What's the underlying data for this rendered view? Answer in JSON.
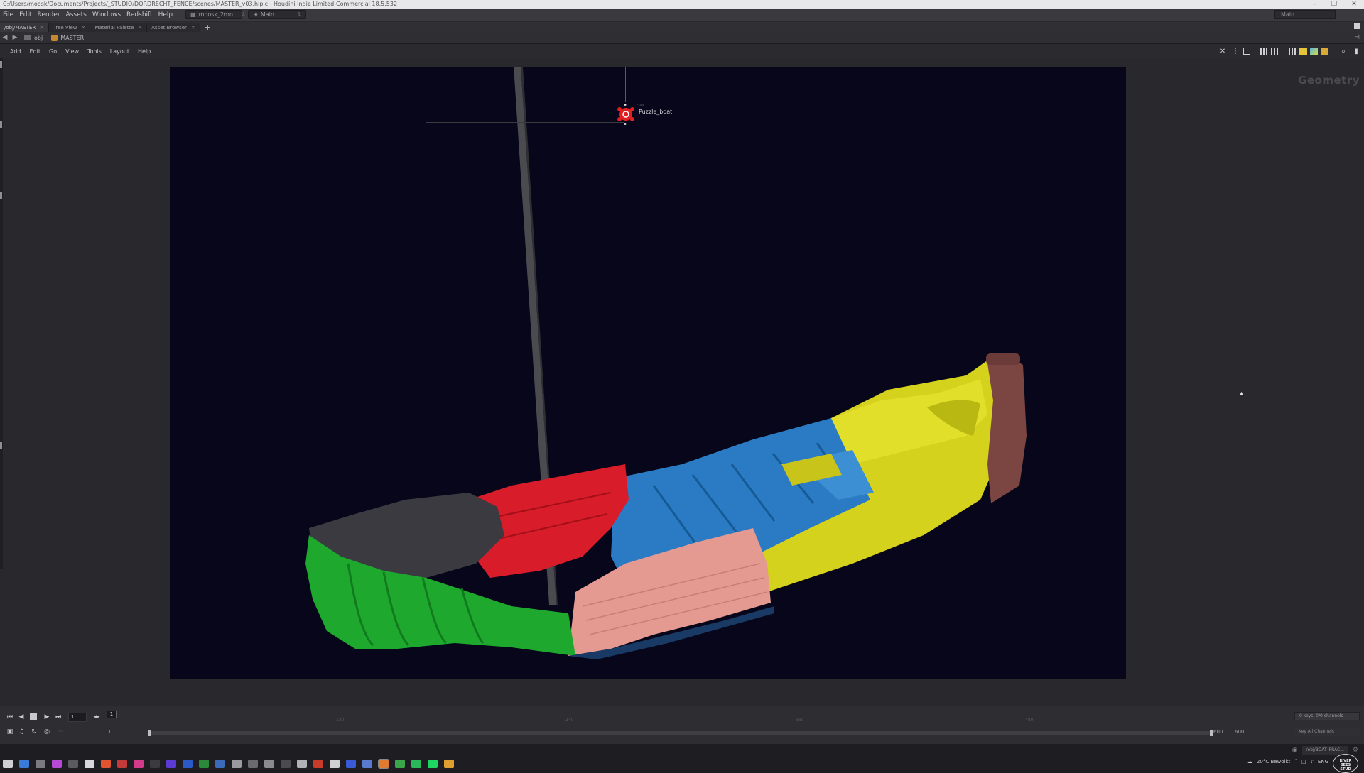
{
  "window": {
    "title": "C:/Users/moosk/Documents/Projects/_STUDIO/DORDRECHT_FENCE/scenes/MASTER_v03.hiplc - Houdini Indie Limited-Commercial 18.5.532",
    "controls": [
      "–",
      "❐",
      "✕"
    ]
  },
  "menubar": {
    "items": [
      "File",
      "Edit",
      "Render",
      "Assets",
      "Windows",
      "Redshift",
      "Help"
    ],
    "desktop_value": "moosk_2mo...",
    "main_value": "Main",
    "right_value": "Main"
  },
  "tabs": [
    {
      "label": "/obj/MASTER",
      "active": true
    },
    {
      "label": "Tree View",
      "active": false
    },
    {
      "label": "Material Palette",
      "active": false
    },
    {
      "label": "Asset Browser",
      "active": false
    }
  ],
  "pathbar": {
    "obj": "obj",
    "current": "MASTER"
  },
  "pane_menu": {
    "items": [
      "Add",
      "Edit",
      "Go",
      "View",
      "Tools",
      "Layout",
      "Help"
    ]
  },
  "network": {
    "pane_type": "Geometry",
    "node": {
      "flag": "Flair",
      "label": "Puzzle_boat"
    }
  },
  "timeline": {
    "frame": "1",
    "frame_marker": "1",
    "ticks": [
      "120",
      "240",
      "360",
      "480"
    ],
    "range_start": "1",
    "range_start2": "1",
    "range_end": "600",
    "range_end2": "600",
    "keys_info": "0 keys, 0/0 channels",
    "key_all": "Key All Channels",
    "status_node": "/obj/BOAT_FRAC..."
  },
  "taskbar": {
    "weather": "20°C  Bewolkt",
    "lang": "ENG",
    "logo": "RIVER BEES STUDIO"
  },
  "colors": {
    "accent": "#c68a2e",
    "bg_image": "#07061a",
    "node": "#e02020"
  }
}
